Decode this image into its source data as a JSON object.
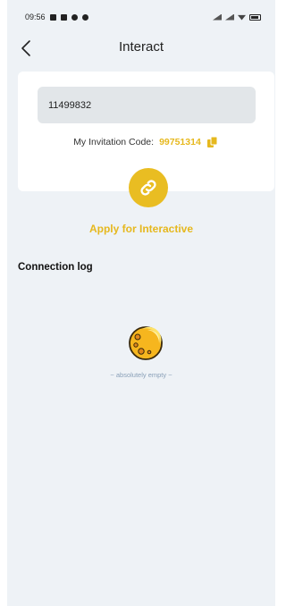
{
  "status_bar": {
    "time": "09:56"
  },
  "header": {
    "title": "Interact",
    "back_icon": "chevron-left-icon"
  },
  "card": {
    "id_value": "11499832",
    "invite_label": "My Invitation Code:",
    "invite_code": "99751314",
    "copy_icon": "copy-icon"
  },
  "apply": {
    "icon": "link-icon",
    "label": "Apply for Interactive"
  },
  "log": {
    "title": "Connection log",
    "empty_icon": "moon-icon",
    "empty_text": "~ absolutely empty ~"
  },
  "colors": {
    "accent": "#e6b81e",
    "background": "#eef2f6",
    "muted_text": "#8aa0b8"
  }
}
